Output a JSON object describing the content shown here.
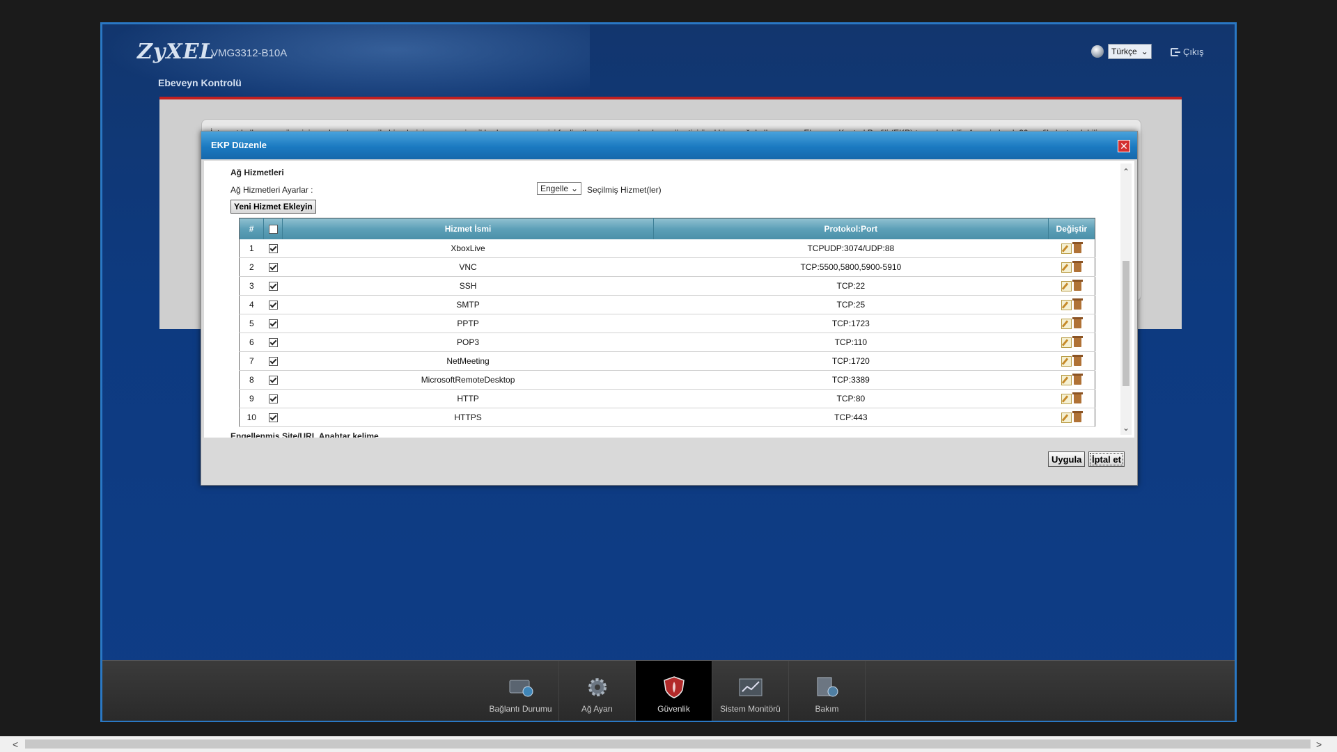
{
  "header": {
    "logo": "ZyXEL",
    "model": "VMG3312-B10A",
    "page_title": "Ebeveyn Kontrolü",
    "language": "Türkçe",
    "logout": "Çıkış"
  },
  "content": {
    "intro": "İnternet kullanımın süresini sınırlamak veya aile bireylerini uygunsuz içeriklerden ve çevrim içi faaliyetlerden korumak adına, yönetici özel bir ev ağı kullanıcısına Ebeveyn Kontrol Profili (EKP) tanımlayabilir. Azami olarak 20 profil oluşturulabilir."
  },
  "modal": {
    "title": "EKP Düzenle",
    "section_title": "Ağ Hizmetleri",
    "settings_label": "Ağ Hizmetleri Ayarlar :",
    "action_value": "Engelle",
    "selected_services_label": "Seçilmiş Hizmet(ler)",
    "add_service": "Yeni Hizmet Ekleyin",
    "table_headers": {
      "index": "#",
      "name": "Hizmet İsmi",
      "protocol": "Protokol:Port",
      "modify": "Değiştir"
    },
    "rows": [
      {
        "n": "1",
        "name": "XboxLive",
        "proto": "TCPUDP:3074/UDP:88"
      },
      {
        "n": "2",
        "name": "VNC",
        "proto": "TCP:5500,5800,5900-5910"
      },
      {
        "n": "3",
        "name": "SSH",
        "proto": "TCP:22"
      },
      {
        "n": "4",
        "name": "SMTP",
        "proto": "TCP:25"
      },
      {
        "n": "5",
        "name": "PPTP",
        "proto": "TCP:1723"
      },
      {
        "n": "6",
        "name": "POP3",
        "proto": "TCP:110"
      },
      {
        "n": "7",
        "name": "NetMeeting",
        "proto": "TCP:1720"
      },
      {
        "n": "8",
        "name": "MicrosoftRemoteDesktop",
        "proto": "TCP:3389"
      },
      {
        "n": "9",
        "name": "HTTP",
        "proto": "TCP:80"
      },
      {
        "n": "10",
        "name": "HTTPS",
        "proto": "TCP:443"
      }
    ],
    "blocked_title": "Engellenmiş Site/URL Anahtar kelime",
    "apply": "Uygula",
    "cancel": "İptal et"
  },
  "nav": {
    "items": [
      {
        "label": "Bağlantı Durumu",
        "icon": "connection-status-icon"
      },
      {
        "label": "Ağ Ayarı",
        "icon": "gear-icon"
      },
      {
        "label": "Güvenlik",
        "icon": "shield-icon"
      },
      {
        "label": "Sistem Monitörü",
        "icon": "monitor-chart-icon"
      },
      {
        "label": "Bakım",
        "icon": "maintenance-icon"
      }
    ],
    "active_index": 2
  },
  "colors": {
    "accent_red": "#c22020",
    "header_blue": "#1b7ac1",
    "table_header": "#5c9fb7"
  }
}
